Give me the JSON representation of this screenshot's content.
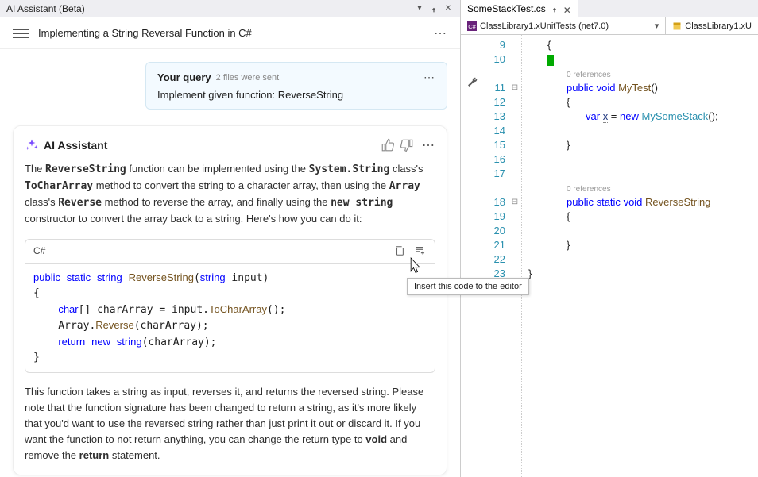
{
  "panel": {
    "title": "AI Assistant (Beta)",
    "chat_title": "Implementing a String Reversal Function in C#"
  },
  "query": {
    "label": "Your query",
    "meta": "2 files were sent",
    "body": "Implement given function: ReverseString"
  },
  "response": {
    "title": "AI Assistant",
    "pre_text_html": "The <code>ReverseString</code> function can be implemented using the <code>System.String</code> class's <code>ToCharArray</code> method to convert the string to a character array, then using the <code>Array</code> class's <code>Reverse</code> method to reverse the array, and finally using the <code>new string</code> constructor to convert the array back to a string. Here's how you can do it:",
    "code_lang": "C#",
    "code_html": "<span class=\"kw\">public</span> <span class=\"kw\">static</span> <span class=\"kw\">string</span> <span class=\"mtd\">ReverseString</span>(<span class=\"kw\">string</span> input)\n{\n    <span class=\"kw\">char</span>[] charArray = input.<span class=\"mtd\">ToCharArray</span>();\n    Array.<span class=\"mtd\">Reverse</span>(charArray);\n    <span class=\"kw\">return</span> <span class=\"kw\">new</span> <span class=\"kw\">string</span>(charArray);\n}",
    "post_text_html": "This function takes a string as input, reverses it, and returns the reversed string. Please note that the function signature has been changed to return a string, as it's more likely that you'd want to use the reversed string rather than just print it out or discard it. If you want the function to not return anything, you can change the return type to <strong>void</strong> and remove the <strong>return</strong> statement."
  },
  "tooltip": "Insert this code to the editor",
  "editor": {
    "tab": "SomeStackTest.cs",
    "crumb1": "ClassLibrary1.xUnitTests (net7.0)",
    "crumb2": "ClassLibrary1.xU",
    "codelens": "0 references",
    "gutter": [
      "9",
      "10",
      "",
      "11",
      "12",
      "13",
      "14",
      "15",
      "16",
      "17",
      "",
      "18",
      "19",
      "20",
      "21",
      "22",
      "23"
    ],
    "lines_html": [
      "<span class=\"cl\">{</span>",
      "<span class=\"ln10-caret\"></span>",
      "",
      "<span class=\"cl\"><span class=\"kw\">public</span> <span class=\"kw dotted-under\">void</span> <span class=\"mtd\">MyTest</span>()</span>",
      "<span class=\"cl\">{</span>",
      "<span class=\"cl\">    <span class=\"kw\">var</span> <span class=\"var dotted-under\">x</span> = <span class=\"kw\">new</span> <span class=\"type\">MySomeStack</span>();</span>",
      "<span class=\"cl\"></span>",
      "<span class=\"cl\">}</span>",
      "",
      "",
      "",
      "<span class=\"cl\"><span class=\"kw\">public</span> <span class=\"kw\">static</span> <span class=\"kw\">void</span> <span class=\"mtd\">ReverseString</span></span>",
      "<span class=\"cl\">{</span>",
      "<span class=\"cl\"></span>",
      "<span class=\"cl\">}</span>",
      "",
      "<span class=\"cl\">}</span>"
    ]
  }
}
